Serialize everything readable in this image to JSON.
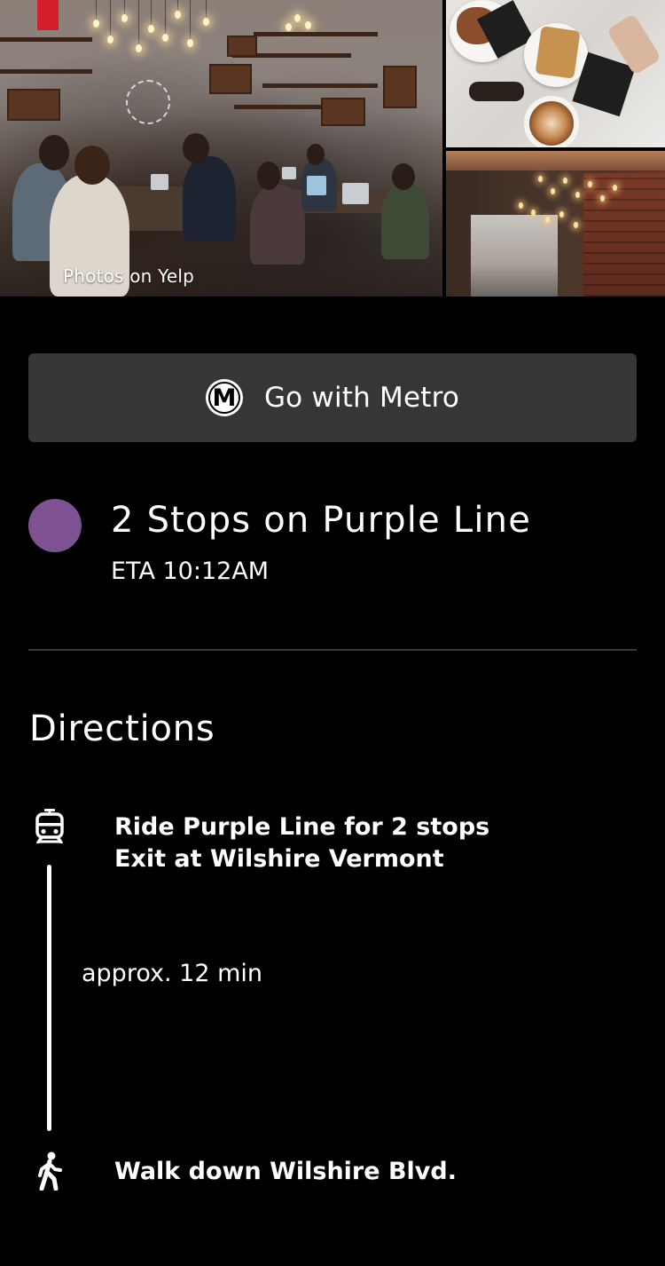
{
  "gallery": {
    "caption": "Photos on Yelp",
    "photos": [
      {
        "description": "cafe interior with people working on laptops"
      },
      {
        "description": "pastries and latte on marble table"
      },
      {
        "description": "cafe interior with hanging bulbs and brick wall"
      }
    ]
  },
  "metro_button": {
    "logo_letter": "M",
    "label": "Go with Metro"
  },
  "route": {
    "title": "2 Stops on Purple Line",
    "eta": "ETA 10:12AM",
    "line_color": "#7e5292"
  },
  "directions": {
    "heading": "Directions",
    "steps": [
      {
        "icon": "train-icon",
        "lines": [
          "Ride Purple Line for 2 stops",
          "Exit at Wilshire Vermont"
        ]
      },
      {
        "icon": "walk-icon",
        "lines": [
          "Walk down Wilshire Blvd."
        ]
      }
    ],
    "duration": "approx. 12 min"
  },
  "colors": {
    "background": "#000000",
    "button_bg": "#363636",
    "divider": "#3a3a3a",
    "text": "#ffffff"
  }
}
